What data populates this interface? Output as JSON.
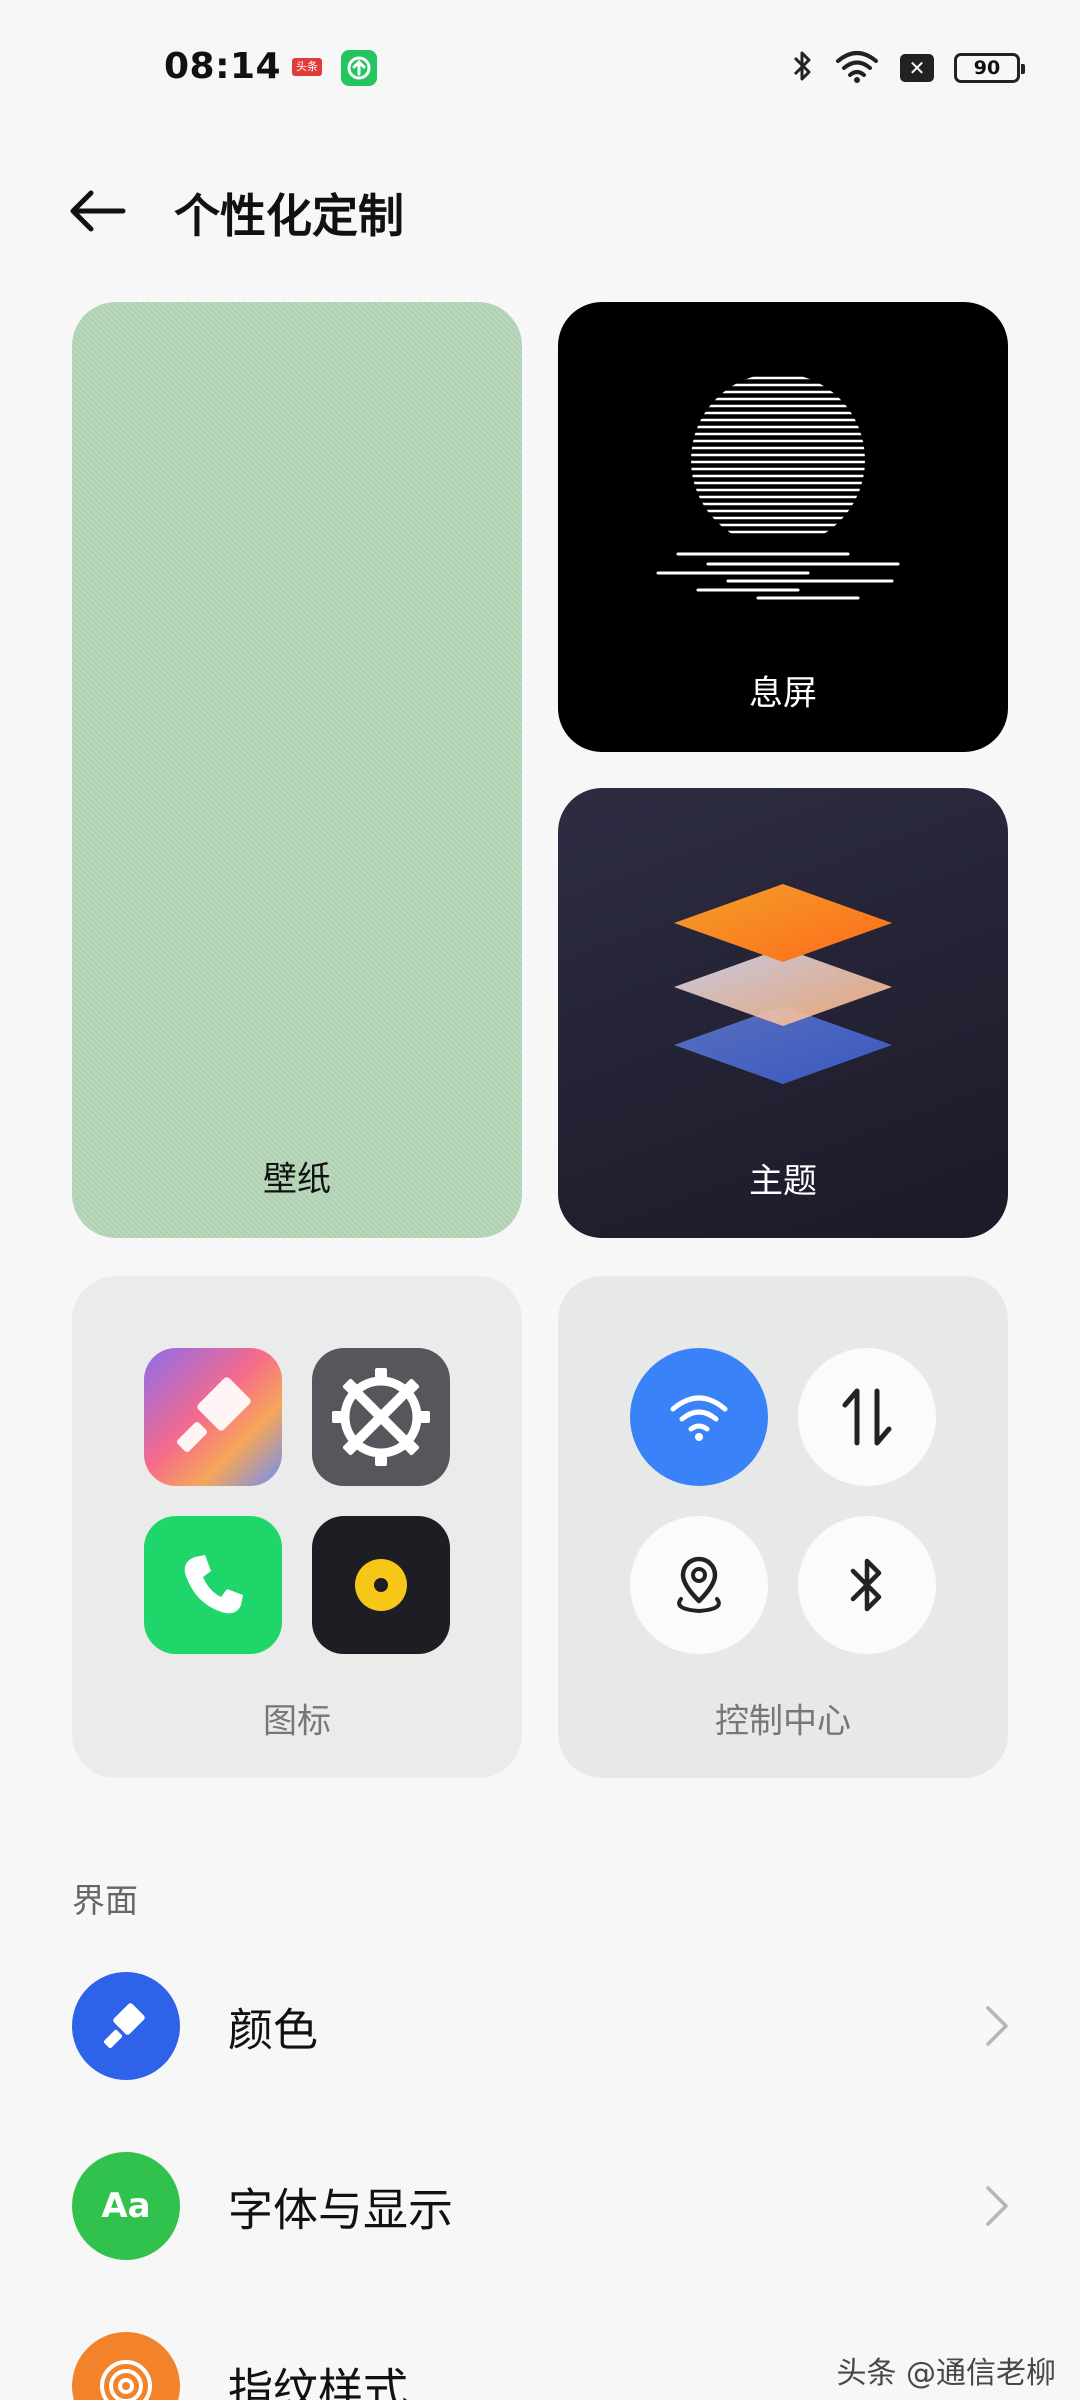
{
  "status_bar": {
    "time": "08:14",
    "app_badge": "头条",
    "battery": "90",
    "icons": [
      "toutiao-icon",
      "upload-icon",
      "bluetooth-icon",
      "wifi-icon",
      "sim-x-icon",
      "battery-icon"
    ]
  },
  "header": {
    "back_icon": "arrow-left-icon",
    "title": "个性化定制"
  },
  "cards": {
    "wallpaper": "壁纸",
    "aod": "息屏",
    "theme": "主题",
    "icons": "图标",
    "control_center": "控制中心"
  },
  "section": {
    "title": "界面",
    "items": [
      {
        "label": "颜色",
        "icon": "brush-icon",
        "color": "#2e62e8"
      },
      {
        "label": "字体与显示",
        "icon": "font-icon",
        "icon_text": "Aa",
        "color": "#31c24d"
      },
      {
        "label": "指纹样式",
        "icon": "fingerprint-icon",
        "color": "#f2832a"
      }
    ]
  },
  "colors": {
    "wallpaper_green": "#b6d7b8",
    "wifi_blue": "#3a82f7"
  },
  "watermark": "头条 @通信老柳"
}
